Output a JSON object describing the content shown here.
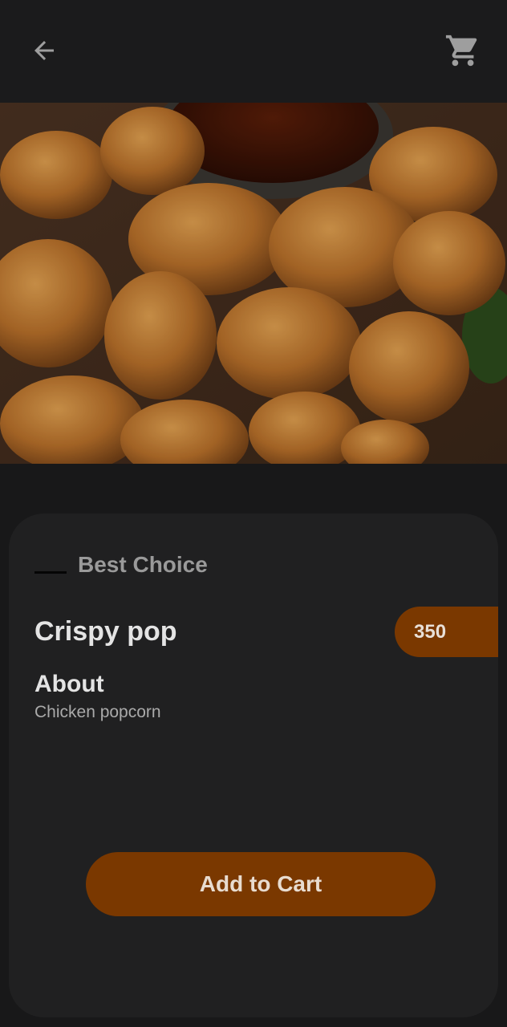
{
  "header": {
    "back_icon": "arrow-left-icon",
    "cart_icon": "shopping-cart-icon"
  },
  "hero": {
    "image_subject": "crispy fried chicken popcorn with dipping sauce"
  },
  "product": {
    "tag": "Best Choice",
    "name": "Crispy pop",
    "price": "350",
    "about_heading": "About",
    "description": "Chicken popcorn"
  },
  "actions": {
    "add_to_cart_label": "Add to Cart"
  },
  "colors": {
    "background": "#181819",
    "card": "#202021",
    "accent": "#7a3800",
    "text_primary": "#e4e4e4",
    "text_muted": "#9a9a9a"
  }
}
